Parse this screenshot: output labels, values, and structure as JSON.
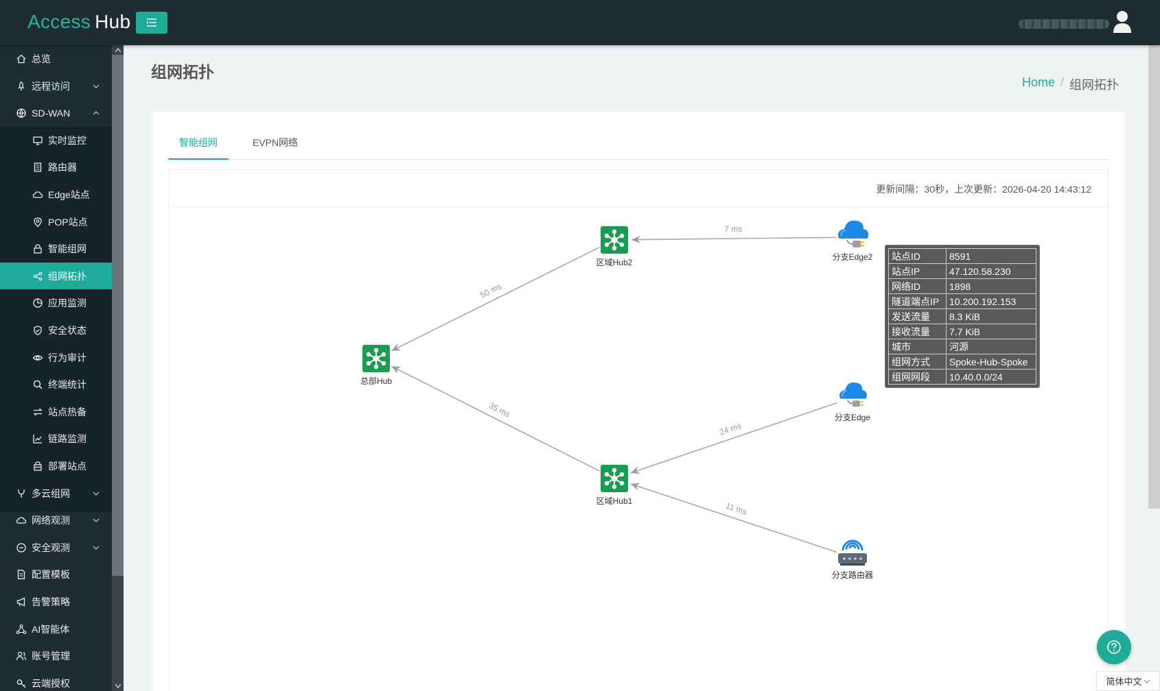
{
  "brand": {
    "part1": "Access",
    "part2": "Hub"
  },
  "sidebar": {
    "items": [
      {
        "label": "总览",
        "icon": "home-icon",
        "type": "top"
      },
      {
        "label": "远程访问",
        "icon": "rocket-icon",
        "type": "top",
        "expandable": true
      },
      {
        "label": "SD-WAN",
        "icon": "globe-icon",
        "type": "top",
        "expanded": true
      },
      {
        "label": "实时监控",
        "icon": "monitor-icon",
        "type": "sub"
      },
      {
        "label": "路由器",
        "icon": "router-icon",
        "type": "sub"
      },
      {
        "label": "Edge站点",
        "icon": "cloud-icon",
        "type": "sub"
      },
      {
        "label": "POP站点",
        "icon": "pin-icon",
        "type": "sub"
      },
      {
        "label": "智能组网",
        "icon": "lock-icon",
        "type": "sub"
      },
      {
        "label": "组网拓扑",
        "icon": "share-icon",
        "type": "sub",
        "active": true
      },
      {
        "label": "应用监测",
        "icon": "pie-icon",
        "type": "sub"
      },
      {
        "label": "安全状态",
        "icon": "shield-icon",
        "type": "sub"
      },
      {
        "label": "行为审计",
        "icon": "eye-icon",
        "type": "sub"
      },
      {
        "label": "终端统计",
        "icon": "search-icon",
        "type": "sub"
      },
      {
        "label": "站点热备",
        "icon": "swap-icon",
        "type": "sub"
      },
      {
        "label": "链路监测",
        "icon": "linechart-icon",
        "type": "sub"
      },
      {
        "label": "部署站点",
        "icon": "box-icon",
        "type": "sub"
      },
      {
        "label": "多云组网",
        "icon": "fork-icon",
        "type": "top",
        "expandable": true
      },
      {
        "label": "网络观测",
        "icon": "cloud-icon",
        "type": "top",
        "expandable": true
      },
      {
        "label": "安全观测",
        "icon": "minus-circle-icon",
        "type": "top",
        "expandable": true
      },
      {
        "label": "配置模板",
        "icon": "document-icon",
        "type": "top"
      },
      {
        "label": "告警策略",
        "icon": "megaphone-icon",
        "type": "top"
      },
      {
        "label": "AI智能体",
        "icon": "cluster-icon",
        "type": "top"
      },
      {
        "label": "账号管理",
        "icon": "users-icon",
        "type": "top"
      },
      {
        "label": "云端授权",
        "icon": "key-icon",
        "type": "top"
      }
    ]
  },
  "page": {
    "title": "组网拓扑"
  },
  "breadcrumb": {
    "home": "Home",
    "sep": "/",
    "current": "组网拓扑"
  },
  "tabs": [
    {
      "label": "智能组网",
      "active": true
    },
    {
      "label": "EVPN网络",
      "active": false
    }
  ],
  "update_info": "更新间隔：30秒，上次更新：2026-04-20 14:43:12",
  "topology": {
    "nodes": [
      {
        "id": "hq",
        "label": "总部Hub",
        "kind": "hub-icon"
      },
      {
        "id": "hub2",
        "label": "区域Hub2",
        "kind": "hub-icon"
      },
      {
        "id": "hub1",
        "label": "区域Hub1",
        "kind": "hub-icon"
      },
      {
        "id": "edge2",
        "label": "分支Edge2",
        "kind": "cloud-plug-icon"
      },
      {
        "id": "edge",
        "label": "分支Edge",
        "kind": "cloud-plug-icon"
      },
      {
        "id": "router",
        "label": "分支路由器",
        "kind": "wifi-router-icon"
      }
    ],
    "links": [
      {
        "from": "hub2",
        "to": "hq",
        "label": "50 ms"
      },
      {
        "from": "hub1",
        "to": "hq",
        "label": "35 ms"
      },
      {
        "from": "edge2",
        "to": "hub2",
        "label": "7 ms"
      },
      {
        "from": "edge",
        "to": "hub1",
        "label": "24 ms"
      },
      {
        "from": "router",
        "to": "hub1",
        "label": "11 ms"
      }
    ]
  },
  "tooltip": {
    "rows": [
      {
        "k": "站点ID",
        "v": "8591"
      },
      {
        "k": "站点IP",
        "v": "47.120.58.230"
      },
      {
        "k": "网络ID",
        "v": "1898"
      },
      {
        "k": "隧道端点IP",
        "v": "10.200.192.153"
      },
      {
        "k": "发送流量",
        "v": "8.3 KiB"
      },
      {
        "k": "接收流量",
        "v": "7.7 KiB"
      },
      {
        "k": "城市",
        "v": "河源"
      },
      {
        "k": "组网方式",
        "v": "Spoke-Hub-Spoke"
      },
      {
        "k": "组网网段",
        "v": "10.40.0.0/24"
      }
    ]
  },
  "language": "简体中文",
  "colors": {
    "accent": "#1eab9a",
    "sidebar": "#1f2d33",
    "hub_green": "#1a9c52"
  }
}
